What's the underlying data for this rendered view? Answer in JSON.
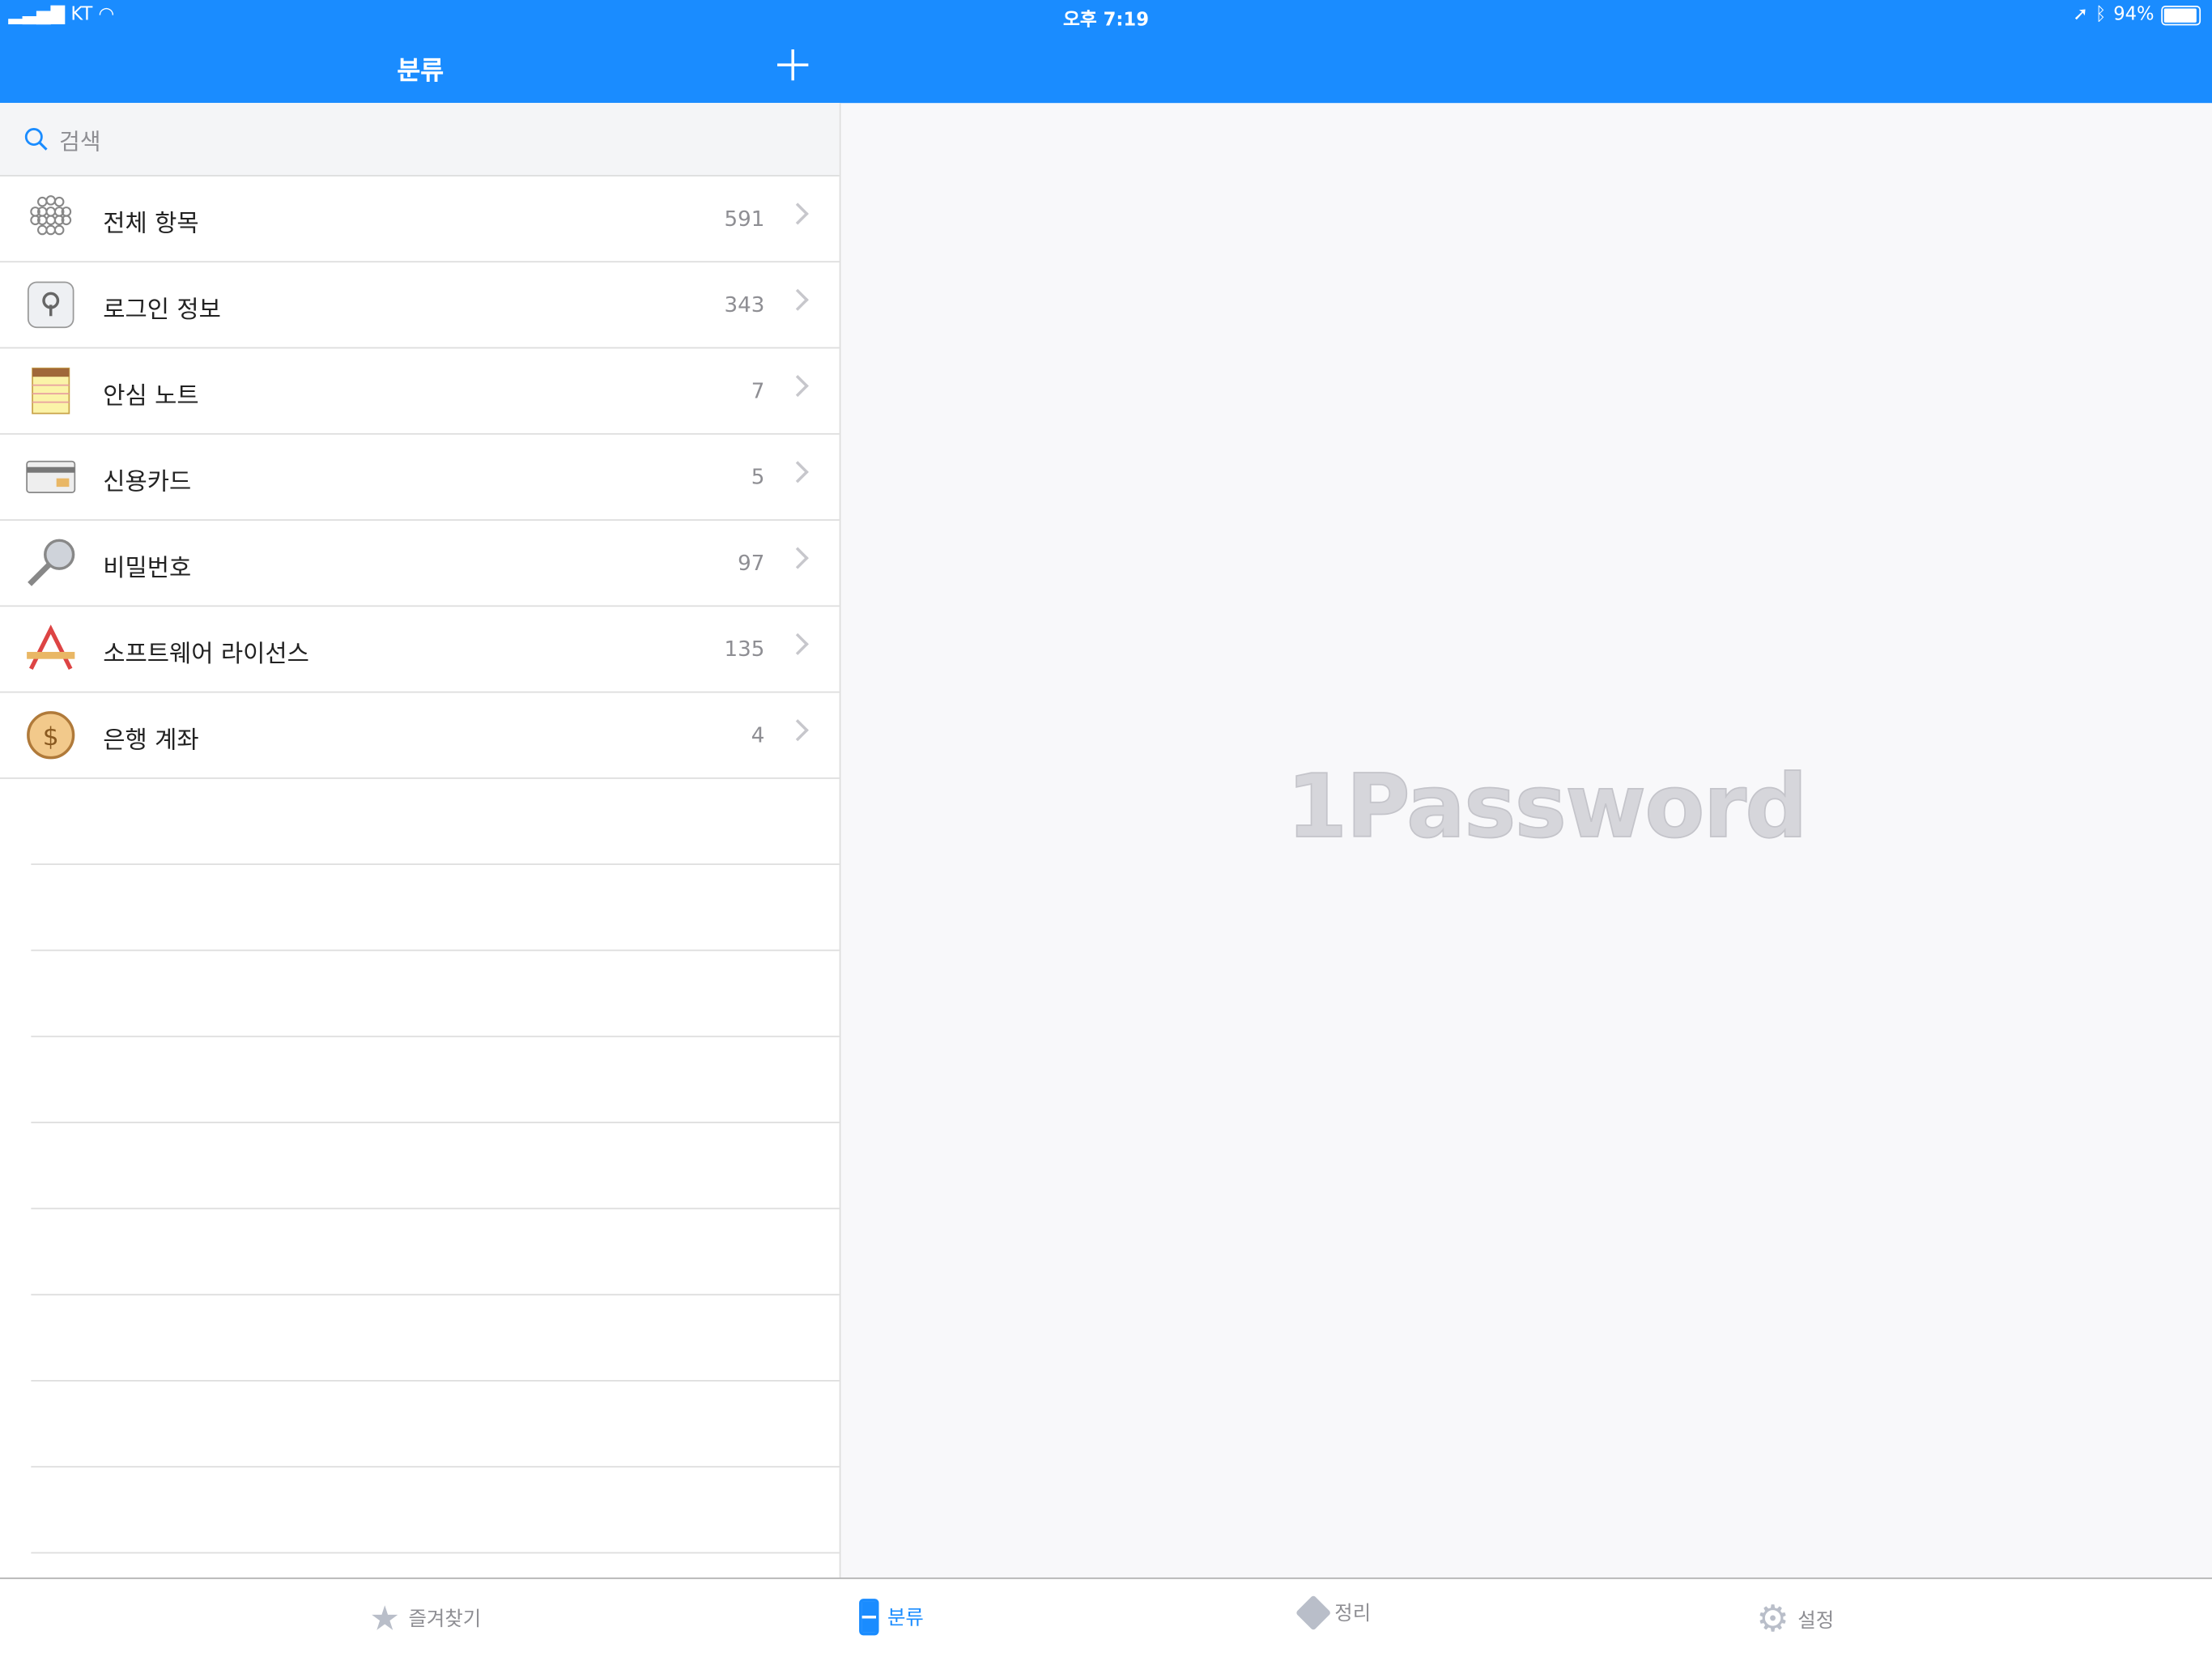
{
  "status_bar": {
    "carrier": "KT",
    "time": "오후 7:19",
    "battery": "94%",
    "battery_level": 0.94
  },
  "nav": {
    "title": "분류"
  },
  "search": {
    "placeholder": "검색"
  },
  "categories": [
    {
      "label": "전체 항목",
      "count": "591",
      "icon": "all-items-icon"
    },
    {
      "label": "로그인 정보",
      "count": "343",
      "icon": "login-icon"
    },
    {
      "label": "안심 노트",
      "count": "7",
      "icon": "secure-note-icon"
    },
    {
      "label": "신용카드",
      "count": "5",
      "icon": "credit-card-icon"
    },
    {
      "label": "비밀번호",
      "count": "97",
      "icon": "password-key-icon"
    },
    {
      "label": "소프트웨어 라이선스",
      "count": "135",
      "icon": "software-license-icon"
    },
    {
      "label": "은행 계좌",
      "count": "4",
      "icon": "bank-account-icon"
    }
  ],
  "detail": {
    "logo": "1Password"
  },
  "tabs": [
    {
      "label": "즐겨찾기",
      "icon": "star-icon",
      "active": false
    },
    {
      "label": "분류",
      "icon": "categories-icon",
      "active": true
    },
    {
      "label": "정리",
      "icon": "tag-icon",
      "active": false
    },
    {
      "label": "설정",
      "icon": "gear-icon",
      "active": false
    }
  ],
  "colors": {
    "accent": "#1a8cff"
  }
}
